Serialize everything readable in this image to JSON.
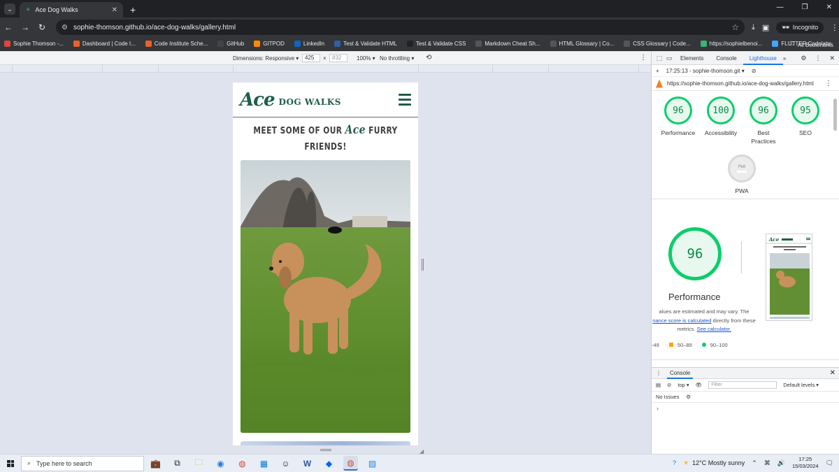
{
  "browser": {
    "tab_title": "Ace Dog Walks",
    "url": "sophie-thomson.github.io/ace-dog-walks/gallery.html",
    "incognito_label": "Incognito",
    "bookmarks": [
      {
        "label": "Sophie Thomson -...",
        "color": "#e0443e"
      },
      {
        "label": "Dashboard | Code I...",
        "color": "#e8612c"
      },
      {
        "label": "Code Institute Sche...",
        "color": "#e8612c"
      },
      {
        "label": "GitHub",
        "color": "#444444"
      },
      {
        "label": "GITPOD",
        "color": "#ff8a00"
      },
      {
        "label": "LinkedIn",
        "color": "#0a66c2"
      },
      {
        "label": "Test & Validate HTML",
        "color": "#2f5fa8"
      },
      {
        "label": "Test & Validate CSS",
        "color": "#222222"
      },
      {
        "label": "Markdown Cheat Sh...",
        "color": "#555555"
      },
      {
        "label": "HTML Glossary | Co...",
        "color": "#555555"
      },
      {
        "label": "CSS Glossary | Code...",
        "color": "#555555"
      },
      {
        "label": "https://sophielbenoi...",
        "color": "#3cb371"
      },
      {
        "label": "FLUTTER Codelabs",
        "color": "#42a5f5"
      }
    ],
    "all_bookmarks": "All Bookmarks"
  },
  "device_toolbar": {
    "dimensions": "Dimensions: Responsive ▾",
    "width": "425",
    "height": "832",
    "times": "×",
    "zoom": "100% ▾",
    "throttling": "No throttling ▾"
  },
  "site": {
    "logo_ace": "Ace",
    "logo_rest": "DOG WALKS",
    "heading_before": "MEET SOME OF OUR ",
    "heading_ace": "Ace",
    "heading_after": " FURRY FRIENDS!"
  },
  "devtools": {
    "tabs": [
      "Elements",
      "Console",
      "Lighthouse"
    ],
    "active_tab": "Lighthouse",
    "report_label": "17:25:13 - sophie-thomson.git ▾",
    "report_url": "https://sophie-thomson.github.io/ace-dog-walks/gallery.html",
    "scores": [
      {
        "label": "Performance",
        "value": "96"
      },
      {
        "label": "Accessibility",
        "value": "100"
      },
      {
        "label": "Best Practices",
        "value": "96"
      },
      {
        "label": "SEO",
        "value": "95"
      }
    ],
    "pwa": {
      "label": "PWA",
      "badge": "PWA"
    },
    "performance": {
      "score": "96",
      "title": "Performance",
      "note_start": "alues are estimated and may vary. The",
      "note_link1": "nance score is calculated",
      "note_mid": " directly from these metrics. ",
      "note_link2": "See calculator.",
      "legend_low": "-49",
      "legend_mid": "50–89",
      "legend_high": "90–100"
    },
    "console": {
      "tab": "Console",
      "context": "top ▾",
      "filter_placeholder": "Filter",
      "levels": "Default levels ▾",
      "issues": "No Issues",
      "prompt": "›"
    }
  },
  "taskbar": {
    "search_placeholder": "Type here to search",
    "weather": "12°C  Mostly sunny",
    "time": "17:25",
    "date": "15/03/2024"
  }
}
